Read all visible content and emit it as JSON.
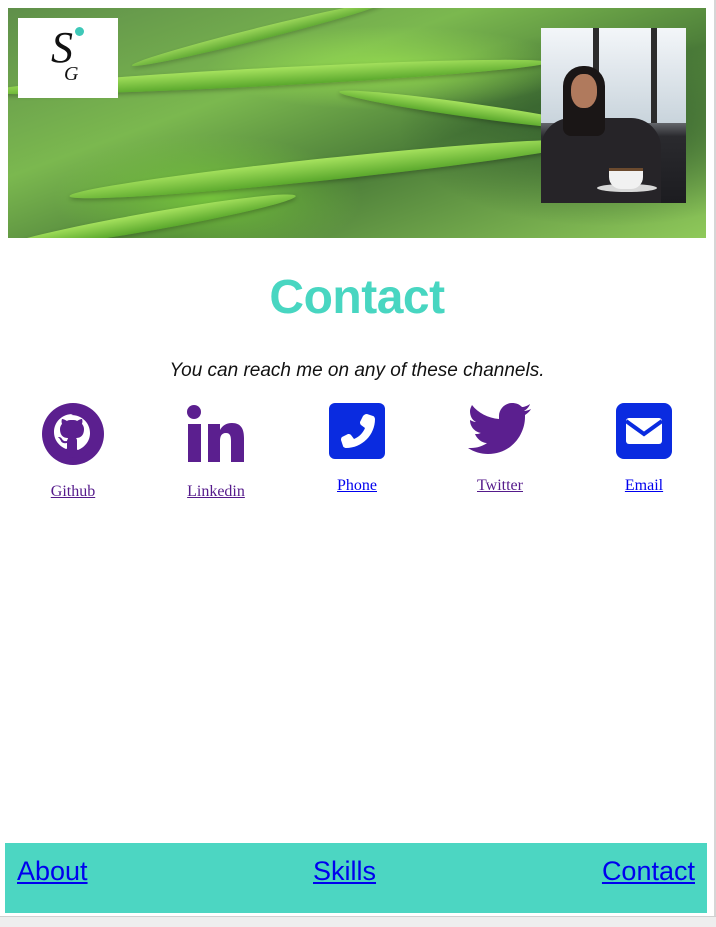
{
  "header": {
    "logo": {
      "letter_main": "S",
      "letter_sub": "G",
      "dot_color": "#3ec8b8"
    },
    "portrait_alt": "profile photo"
  },
  "main": {
    "title": "Contact",
    "tagline": "You can reach me on any of these channels.",
    "channels": [
      {
        "label": "Github",
        "icon": "github-icon",
        "visited": true
      },
      {
        "label": "Linkedin",
        "icon": "linkedin-icon",
        "visited": true
      },
      {
        "label": "Phone",
        "icon": "phone-icon",
        "visited": false
      },
      {
        "label": "Twitter",
        "icon": "twitter-icon",
        "visited": true
      },
      {
        "label": "Email",
        "icon": "envelope-icon",
        "visited": false
      }
    ]
  },
  "footer": {
    "links": [
      {
        "label": "About"
      },
      {
        "label": "Skills"
      },
      {
        "label": "Contact"
      }
    ]
  },
  "colors": {
    "accent": "#48d6c1",
    "footer_bg": "#4cd6c2",
    "icon_purple": "#5b1f8f",
    "icon_blue": "#0a2be0",
    "link_unvisited": "#0000ee",
    "link_visited": "#551a8b"
  }
}
